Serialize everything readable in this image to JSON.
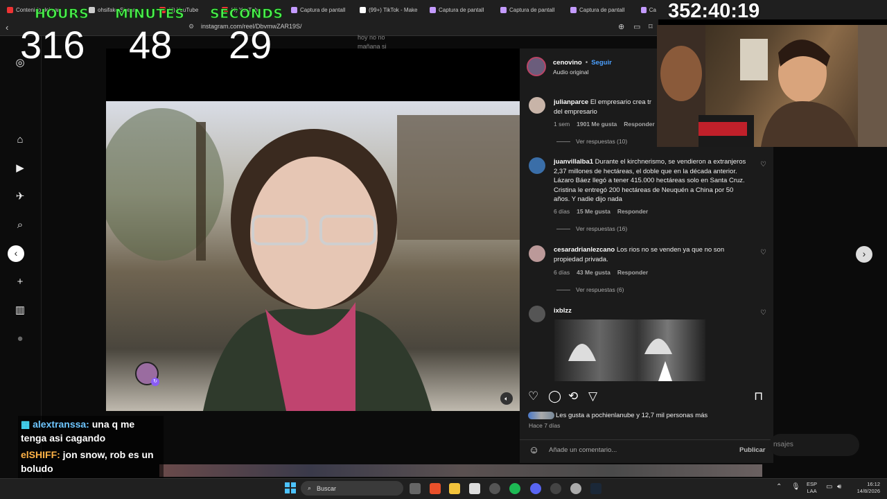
{
  "browser": {
    "tabs": [
      "Contenido del can",
      "ohsifake Stream",
      "(4) YouTube",
      "(4) YouTube",
      "Captura de pantall",
      "(99+) TikTok - Make",
      "Captura de pantall",
      "Captura de pantall",
      "Captura de pantall",
      "Ca"
    ],
    "url": "instagram.com/reel/DbvmwZAR19S/"
  },
  "overlay": {
    "timer": {
      "hours_label": "HOURS",
      "minutes_label": "MINUTES",
      "seconds_label": "SECONDS",
      "hours": "316",
      "minutes": "48",
      "seconds": "29"
    },
    "stream_time": "352:40:19",
    "chat": [
      {
        "user": "alextranssa:",
        "text": "una q me tenga asi cagando"
      },
      {
        "user": "elSHIFF:",
        "text": "jon snow, rob es un boludo"
      }
    ]
  },
  "behind_text": [
    "hoy no no",
    "mañana si"
  ],
  "post": {
    "username": "cenovino",
    "follow": "Seguir",
    "audio": "Audio original",
    "comments": [
      {
        "user": "julianparce",
        "text": "El empresario crea tr del empresario",
        "time": "1 sem",
        "likes": "1901 Me gusta",
        "reply": "Responder",
        "replies": "Ver respuestas (10)"
      },
      {
        "user": "juanvillalba1",
        "text": "Durante el kirchnerismo, se vendieron a extranjeros 2,37 millones de hectáreas, el doble que en la década anterior. Lázaro Báez llegó a tener 415.000 hectáreas solo en Santa Cruz. Cristina le entregó 200 hectáreas de Neuquén a China por 50 años. Y nadie dijo nada",
        "time": "6 días",
        "likes": "15 Me gusta",
        "reply": "Responder",
        "replies": "Ver respuestas (16)"
      },
      {
        "user": "cesaradrianlezcano",
        "text": "Los rios no se venden ya que no son propiedad privada.",
        "time": "6 días",
        "likes": "43 Me gusta",
        "reply": "Responder",
        "replies": "Ver respuestas (6)"
      },
      {
        "user": "ixblzz",
        "text": ""
      }
    ],
    "likes_text": "Les gusta a pochienlanube y 12,7 mil personas más",
    "posted_ago": "Hace 7 días",
    "comment_placeholder": "Añade un comentario...",
    "publish": "Publicar"
  },
  "messages_hint": "nsajes",
  "taskbar": {
    "search": "Buscar",
    "lang": "ESP",
    "lang2": "LAA",
    "time": "16:12",
    "date": "14/8/2026"
  }
}
